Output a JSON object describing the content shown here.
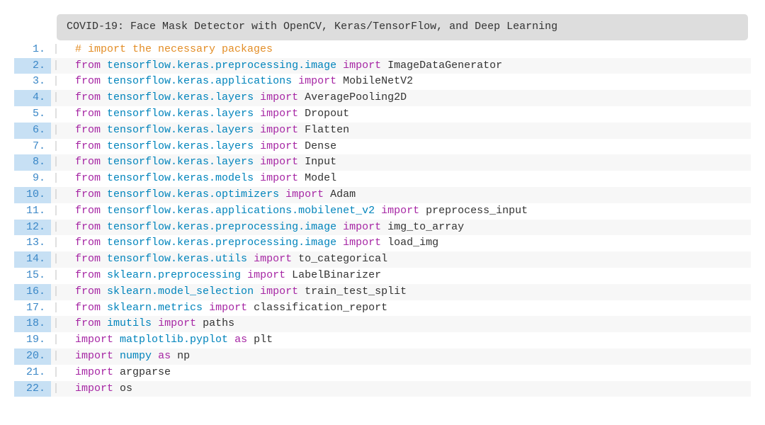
{
  "title": "COVID-19: Face Mask Detector with OpenCV, Keras/TensorFlow, and Deep Learning",
  "code": [
    {
      "n": 1,
      "line": [
        {
          "t": "comment",
          "s": "# import the necessary packages"
        }
      ]
    },
    {
      "n": 2,
      "line": [
        {
          "t": "keyword",
          "s": "from"
        },
        {
          "t": "space"
        },
        {
          "t": "module",
          "s": "tensorflow.keras.preprocessing.image"
        },
        {
          "t": "space"
        },
        {
          "t": "keyword",
          "s": "import"
        },
        {
          "t": "space"
        },
        {
          "t": "name",
          "s": "ImageDataGenerator"
        }
      ]
    },
    {
      "n": 3,
      "line": [
        {
          "t": "keyword",
          "s": "from"
        },
        {
          "t": "space"
        },
        {
          "t": "module",
          "s": "tensorflow.keras.applications"
        },
        {
          "t": "space"
        },
        {
          "t": "keyword",
          "s": "import"
        },
        {
          "t": "space"
        },
        {
          "t": "name",
          "s": "MobileNetV2"
        }
      ]
    },
    {
      "n": 4,
      "line": [
        {
          "t": "keyword",
          "s": "from"
        },
        {
          "t": "space"
        },
        {
          "t": "module",
          "s": "tensorflow.keras.layers"
        },
        {
          "t": "space"
        },
        {
          "t": "keyword",
          "s": "import"
        },
        {
          "t": "space"
        },
        {
          "t": "name",
          "s": "AveragePooling2D"
        }
      ]
    },
    {
      "n": 5,
      "line": [
        {
          "t": "keyword",
          "s": "from"
        },
        {
          "t": "space"
        },
        {
          "t": "module",
          "s": "tensorflow.keras.layers"
        },
        {
          "t": "space"
        },
        {
          "t": "keyword",
          "s": "import"
        },
        {
          "t": "space"
        },
        {
          "t": "name",
          "s": "Dropout"
        }
      ]
    },
    {
      "n": 6,
      "line": [
        {
          "t": "keyword",
          "s": "from"
        },
        {
          "t": "space"
        },
        {
          "t": "module",
          "s": "tensorflow.keras.layers"
        },
        {
          "t": "space"
        },
        {
          "t": "keyword",
          "s": "import"
        },
        {
          "t": "space"
        },
        {
          "t": "name",
          "s": "Flatten"
        }
      ]
    },
    {
      "n": 7,
      "line": [
        {
          "t": "keyword",
          "s": "from"
        },
        {
          "t": "space"
        },
        {
          "t": "module",
          "s": "tensorflow.keras.layers"
        },
        {
          "t": "space"
        },
        {
          "t": "keyword",
          "s": "import"
        },
        {
          "t": "space"
        },
        {
          "t": "name",
          "s": "Dense"
        }
      ]
    },
    {
      "n": 8,
      "line": [
        {
          "t": "keyword",
          "s": "from"
        },
        {
          "t": "space"
        },
        {
          "t": "module",
          "s": "tensorflow.keras.layers"
        },
        {
          "t": "space"
        },
        {
          "t": "keyword",
          "s": "import"
        },
        {
          "t": "space"
        },
        {
          "t": "name",
          "s": "Input"
        }
      ]
    },
    {
      "n": 9,
      "line": [
        {
          "t": "keyword",
          "s": "from"
        },
        {
          "t": "space"
        },
        {
          "t": "module",
          "s": "tensorflow.keras.models"
        },
        {
          "t": "space"
        },
        {
          "t": "keyword",
          "s": "import"
        },
        {
          "t": "space"
        },
        {
          "t": "name",
          "s": "Model"
        }
      ]
    },
    {
      "n": 10,
      "line": [
        {
          "t": "keyword",
          "s": "from"
        },
        {
          "t": "space"
        },
        {
          "t": "module",
          "s": "tensorflow.keras.optimizers"
        },
        {
          "t": "space"
        },
        {
          "t": "keyword",
          "s": "import"
        },
        {
          "t": "space"
        },
        {
          "t": "name",
          "s": "Adam"
        }
      ]
    },
    {
      "n": 11,
      "line": [
        {
          "t": "keyword",
          "s": "from"
        },
        {
          "t": "space"
        },
        {
          "t": "module",
          "s": "tensorflow.keras.applications.mobilenet_v2"
        },
        {
          "t": "space"
        },
        {
          "t": "keyword",
          "s": "import"
        },
        {
          "t": "space"
        },
        {
          "t": "name",
          "s": "preprocess_input"
        }
      ]
    },
    {
      "n": 12,
      "line": [
        {
          "t": "keyword",
          "s": "from"
        },
        {
          "t": "space"
        },
        {
          "t": "module",
          "s": "tensorflow.keras.preprocessing.image"
        },
        {
          "t": "space"
        },
        {
          "t": "keyword",
          "s": "import"
        },
        {
          "t": "space"
        },
        {
          "t": "name",
          "s": "img_to_array"
        }
      ]
    },
    {
      "n": 13,
      "line": [
        {
          "t": "keyword",
          "s": "from"
        },
        {
          "t": "space"
        },
        {
          "t": "module",
          "s": "tensorflow.keras.preprocessing.image"
        },
        {
          "t": "space"
        },
        {
          "t": "keyword",
          "s": "import"
        },
        {
          "t": "space"
        },
        {
          "t": "name",
          "s": "load_img"
        }
      ]
    },
    {
      "n": 14,
      "line": [
        {
          "t": "keyword",
          "s": "from"
        },
        {
          "t": "space"
        },
        {
          "t": "module",
          "s": "tensorflow.keras.utils"
        },
        {
          "t": "space"
        },
        {
          "t": "keyword",
          "s": "import"
        },
        {
          "t": "space"
        },
        {
          "t": "name",
          "s": "to_categorical"
        }
      ]
    },
    {
      "n": 15,
      "line": [
        {
          "t": "keyword",
          "s": "from"
        },
        {
          "t": "space"
        },
        {
          "t": "module",
          "s": "sklearn.preprocessing"
        },
        {
          "t": "space"
        },
        {
          "t": "keyword",
          "s": "import"
        },
        {
          "t": "space"
        },
        {
          "t": "name",
          "s": "LabelBinarizer"
        }
      ]
    },
    {
      "n": 16,
      "line": [
        {
          "t": "keyword",
          "s": "from"
        },
        {
          "t": "space"
        },
        {
          "t": "module",
          "s": "sklearn.model_selection"
        },
        {
          "t": "space"
        },
        {
          "t": "keyword",
          "s": "import"
        },
        {
          "t": "space"
        },
        {
          "t": "name",
          "s": "train_test_split"
        }
      ]
    },
    {
      "n": 17,
      "line": [
        {
          "t": "keyword",
          "s": "from"
        },
        {
          "t": "space"
        },
        {
          "t": "module",
          "s": "sklearn.metrics"
        },
        {
          "t": "space"
        },
        {
          "t": "keyword",
          "s": "import"
        },
        {
          "t": "space"
        },
        {
          "t": "name",
          "s": "classification_report"
        }
      ]
    },
    {
      "n": 18,
      "line": [
        {
          "t": "keyword",
          "s": "from"
        },
        {
          "t": "space"
        },
        {
          "t": "module",
          "s": "imutils"
        },
        {
          "t": "space"
        },
        {
          "t": "keyword",
          "s": "import"
        },
        {
          "t": "space"
        },
        {
          "t": "name",
          "s": "paths"
        }
      ]
    },
    {
      "n": 19,
      "line": [
        {
          "t": "keyword",
          "s": "import"
        },
        {
          "t": "space"
        },
        {
          "t": "module",
          "s": "matplotlib.pyplot"
        },
        {
          "t": "space"
        },
        {
          "t": "keyword",
          "s": "as"
        },
        {
          "t": "space"
        },
        {
          "t": "name",
          "s": "plt"
        }
      ]
    },
    {
      "n": 20,
      "line": [
        {
          "t": "keyword",
          "s": "import"
        },
        {
          "t": "space"
        },
        {
          "t": "module",
          "s": "numpy"
        },
        {
          "t": "space"
        },
        {
          "t": "keyword",
          "s": "as"
        },
        {
          "t": "space"
        },
        {
          "t": "name",
          "s": "np"
        }
      ]
    },
    {
      "n": 21,
      "line": [
        {
          "t": "keyword",
          "s": "import"
        },
        {
          "t": "space"
        },
        {
          "t": "name",
          "s": "argparse"
        }
      ]
    },
    {
      "n": 22,
      "line": [
        {
          "t": "keyword",
          "s": "import"
        },
        {
          "t": "space"
        },
        {
          "t": "name",
          "s": "os"
        }
      ]
    }
  ]
}
